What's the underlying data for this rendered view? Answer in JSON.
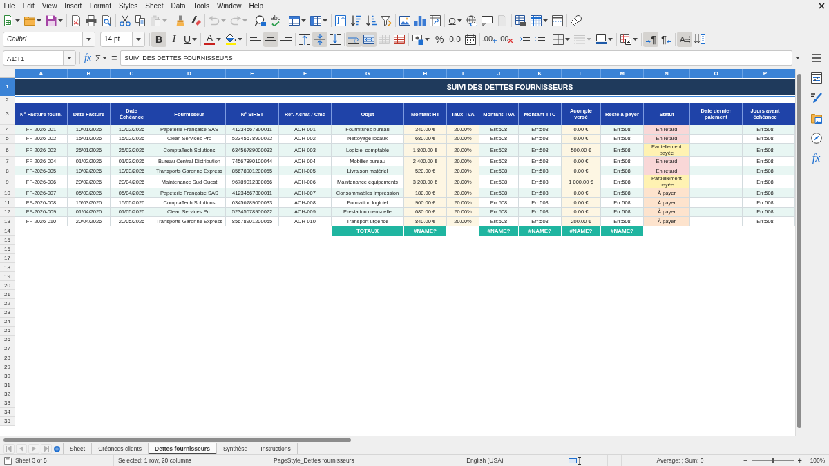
{
  "menu_bar": {
    "items": [
      "File",
      "Edit",
      "View",
      "Insert",
      "Format",
      "Styles",
      "Sheet",
      "Data",
      "Tools",
      "Window",
      "Help"
    ]
  },
  "standard_toolbar": {
    "groups": [
      [
        {
          "kind": "new",
          "dropdown": true,
          "disabled": false
        },
        {
          "kind": "open",
          "dropdown": true,
          "disabled": false
        },
        {
          "kind": "save",
          "dropdown": true,
          "disabled": false
        }
      ],
      [
        {
          "kind": "pdf",
          "dropdown": false,
          "disabled": false
        },
        {
          "kind": "print",
          "dropdown": false,
          "disabled": false
        },
        {
          "kind": "preview",
          "dropdown": false,
          "disabled": false
        }
      ],
      [
        {
          "kind": "cut",
          "dropdown": false,
          "disabled": false
        },
        {
          "kind": "copy",
          "dropdown": false,
          "disabled": false
        },
        {
          "kind": "paste",
          "dropdown": true,
          "disabled": true
        }
      ],
      [
        {
          "kind": "clone",
          "dropdown": false,
          "disabled": false
        },
        {
          "kind": "clear",
          "dropdown": false,
          "disabled": false
        }
      ],
      [
        {
          "kind": "undo",
          "dropdown": true,
          "disabled": true
        },
        {
          "kind": "redo",
          "dropdown": true,
          "disabled": true
        }
      ],
      [
        {
          "kind": "find",
          "dropdown": false,
          "disabled": false
        },
        {
          "kind": "spelling",
          "label": "abc",
          "dropdown": false,
          "disabled": false
        }
      ],
      [
        {
          "kind": "rows",
          "dropdown": true,
          "disabled": false
        },
        {
          "kind": "columns",
          "dropdown": true,
          "disabled": false
        }
      ],
      [
        {
          "kind": "sort",
          "dropdown": false,
          "disabled": false
        },
        {
          "kind": "ascending",
          "dropdown": false,
          "disabled": false
        },
        {
          "kind": "descending",
          "dropdown": false,
          "disabled": false
        },
        {
          "kind": "filter",
          "dropdown": false,
          "disabled": false
        }
      ],
      [
        {
          "kind": "image",
          "dropdown": false,
          "disabled": false
        },
        {
          "kind": "chart",
          "dropdown": false,
          "disabled": false
        },
        {
          "kind": "pivot",
          "dropdown": false,
          "disabled": false
        }
      ],
      [
        {
          "kind": "special",
          "label": "Ω",
          "dropdown": true,
          "disabled": false
        },
        {
          "kind": "hyperlink",
          "dropdown": false,
          "disabled": false
        },
        {
          "kind": "comment",
          "dropdown": false,
          "disabled": false
        },
        {
          "kind": "headers",
          "dropdown": false,
          "disabled": true
        }
      ],
      [
        {
          "kind": "printarea",
          "dropdown": false,
          "disabled": false
        },
        {
          "kind": "freeze",
          "dropdown": true,
          "disabled": false
        },
        {
          "kind": "split",
          "dropdown": false,
          "disabled": false
        }
      ],
      [
        {
          "kind": "shapes",
          "dropdown": false,
          "disabled": false
        }
      ]
    ]
  },
  "formatting_toolbar": {
    "font_name": "Calibri",
    "font_size": "14 pt",
    "groups": [
      [
        {
          "kind": "bold",
          "label": "B",
          "on": true,
          "disabled": false,
          "dropdown": false
        },
        {
          "kind": "italic",
          "label": "I",
          "on": false,
          "disabled": false,
          "dropdown": false
        },
        {
          "kind": "underline",
          "label": "U",
          "on": false,
          "disabled": false,
          "dropdown": true
        }
      ],
      [
        {
          "kind": "fontcolor",
          "label": "A",
          "color": "#c9211e",
          "on": false,
          "disabled": false,
          "dropdown": true
        },
        {
          "kind": "highlight",
          "color": "#ffee00",
          "on": false,
          "disabled": false,
          "dropdown": true
        }
      ],
      [
        {
          "kind": "left",
          "on": false,
          "disabled": false,
          "dropdown": false
        },
        {
          "kind": "center",
          "on": true,
          "disabled": false,
          "dropdown": false
        },
        {
          "kind": "right",
          "on": false,
          "disabled": false,
          "dropdown": false
        }
      ],
      [
        {
          "kind": "top",
          "on": false,
          "disabled": false,
          "dropdown": false
        },
        {
          "kind": "middle",
          "on": true,
          "disabled": false,
          "dropdown": false
        },
        {
          "kind": "bottom",
          "on": false,
          "disabled": false,
          "dropdown": false
        }
      ],
      [
        {
          "kind": "wrap",
          "on": true,
          "disabled": false,
          "dropdown": false
        },
        {
          "kind": "mergecenter",
          "on": true,
          "disabled": false,
          "dropdown": false
        },
        {
          "kind": "merge",
          "on": false,
          "disabled": true,
          "dropdown": false
        },
        {
          "kind": "unmerge",
          "on": false,
          "disabled": false,
          "dropdown": false
        }
      ],
      [
        {
          "kind": "currency",
          "on": false,
          "disabled": false,
          "dropdown": true
        },
        {
          "kind": "percent",
          "label": "%",
          "on": false,
          "disabled": false,
          "dropdown": false
        },
        {
          "kind": "number",
          "label": "0.0",
          "on": false,
          "disabled": false,
          "dropdown": false
        },
        {
          "kind": "date",
          "on": false,
          "disabled": false,
          "dropdown": false
        }
      ],
      [
        {
          "kind": "adddecimal",
          "label": ".00",
          "on": false,
          "disabled": false,
          "dropdown": false
        },
        {
          "kind": "deldecimal",
          "label": ".00",
          "on": false,
          "disabled": false,
          "dropdown": false
        }
      ],
      [
        {
          "kind": "indent",
          "on": false,
          "disabled": false,
          "dropdown": false
        },
        {
          "kind": "outdent",
          "on": false,
          "disabled": false,
          "dropdown": false
        }
      ],
      [
        {
          "kind": "borders",
          "on": false,
          "disabled": false,
          "dropdown": true
        },
        {
          "kind": "borderstyle",
          "on": false,
          "disabled": true,
          "dropdown": true
        },
        {
          "kind": "bordercolor",
          "color": "#1e5aa8",
          "on": false,
          "disabled": false,
          "dropdown": true
        }
      ],
      [
        {
          "kind": "conditional",
          "on": false,
          "disabled": false,
          "dropdown": true
        }
      ],
      [
        {
          "kind": "ltr",
          "label": "¶",
          "on": true,
          "disabled": false,
          "dropdown": false
        },
        {
          "kind": "rtl",
          "label": "¶",
          "on": false,
          "disabled": false,
          "dropdown": false
        }
      ],
      [
        {
          "kind": "horizontal",
          "label": "A",
          "on": true,
          "disabled": false,
          "dropdown": false
        },
        {
          "kind": "vertical",
          "on": false,
          "disabled": false,
          "dropdown": false
        }
      ]
    ]
  },
  "formula_bar": {
    "name_box": "A1:T1",
    "function_wizard": "fx",
    "sum": "Σ",
    "formula": "=",
    "content": "SUIVI DES DETTES FOURNISSEURS"
  },
  "sheet": {
    "column_headers": [
      {
        "label": "A",
        "selected": true
      },
      {
        "label": "B",
        "selected": true
      },
      {
        "label": "C",
        "selected": true
      },
      {
        "label": "D",
        "selected": true
      },
      {
        "label": "E",
        "selected": true
      },
      {
        "label": "F",
        "selected": true
      },
      {
        "label": "G",
        "selected": true
      },
      {
        "label": "H",
        "selected": true
      },
      {
        "label": "I",
        "selected": true
      },
      {
        "label": "J",
        "selected": true
      },
      {
        "label": "K",
        "selected": true
      },
      {
        "label": "L",
        "selected": true
      },
      {
        "label": "M",
        "selected": true
      },
      {
        "label": "N",
        "selected": true
      },
      {
        "label": "O",
        "selected": true
      },
      {
        "label": "P",
        "selected": true
      }
    ],
    "row_numbers": [
      {
        "label": "1",
        "selected": true
      },
      {
        "label": "2",
        "selected": false
      },
      {
        "label": "3",
        "selected": false
      },
      {
        "label": "4",
        "selected": false
      },
      {
        "label": "5",
        "selected": false
      },
      {
        "label": "6",
        "selected": false
      },
      {
        "label": "7",
        "selected": false
      },
      {
        "label": "8",
        "selected": false
      },
      {
        "label": "9",
        "selected": false
      },
      {
        "label": "10",
        "selected": false
      },
      {
        "label": "11",
        "selected": false
      },
      {
        "label": "12",
        "selected": false
      },
      {
        "label": "13",
        "selected": false
      },
      {
        "label": "14",
        "selected": false
      },
      {
        "label": "15",
        "selected": false
      },
      {
        "label": "16",
        "selected": false
      },
      {
        "label": "17",
        "selected": false
      },
      {
        "label": "18",
        "selected": false
      },
      {
        "label": "19",
        "selected": false
      },
      {
        "label": "20",
        "selected": false
      },
      {
        "label": "21",
        "selected": false
      },
      {
        "label": "22",
        "selected": false
      },
      {
        "label": "23",
        "selected": false
      },
      {
        "label": "24",
        "selected": false
      },
      {
        "label": "25",
        "selected": false
      },
      {
        "label": "26",
        "selected": false
      },
      {
        "label": "27",
        "selected": false
      },
      {
        "label": "28",
        "selected": false
      },
      {
        "label": "29",
        "selected": false
      },
      {
        "label": "30",
        "selected": false
      },
      {
        "label": "31",
        "selected": false
      },
      {
        "label": "32",
        "selected": false
      },
      {
        "label": "33",
        "selected": false
      },
      {
        "label": "34",
        "selected": false
      },
      {
        "label": "35",
        "selected": false
      }
    ],
    "title": "SUIVI DES DETTES FOURNISSEURS",
    "table": {
      "columns": [
        "N° Facture fourn.",
        "Date Facture",
        "Date Échéance",
        "Fournisseur",
        "N° SIRET",
        "Réf. Achat / Cmd",
        "Objet",
        "Montant HT",
        "Taux TVA",
        "Montant TVA",
        "Montant TTC",
        "Acompte versé",
        "Reste à payer",
        "Statut",
        "Date dernier paiement",
        "Jours avant échéance"
      ],
      "rows": [
        {
          "invoice": "FF-2026-001",
          "invoice_date": "10/01/2026",
          "due_date": "10/02/2026",
          "supplier": "Papeterie Française SAS",
          "siret": "41234567800011",
          "order_ref": "ACH-001",
          "object": "Fournitures bureau",
          "amount_ht": "340.00 €",
          "vat_rate": "20.00%",
          "vat_amount": "Err:508",
          "amount_ttc": "Err:508",
          "deposit": "0.00 €",
          "remaining": "Err:508",
          "status": "En retard",
          "color": "#f9d7d7",
          "days_to_due": "Err:508"
        },
        {
          "invoice": "FF-2026-002",
          "invoice_date": "15/01/2026",
          "due_date": "15/02/2026",
          "supplier": "Clean Services Pro",
          "siret": "52345678900022",
          "order_ref": "ACH-002",
          "object": "Nettoyage locaux",
          "amount_ht": "680.00 €",
          "vat_rate": "20.00%",
          "vat_amount": "Err:508",
          "amount_ttc": "Err:508",
          "deposit": "0.00 €",
          "remaining": "Err:508",
          "status": "En retard",
          "color": "#f9d7d7",
          "days_to_due": "Err:508"
        },
        {
          "invoice": "FF-2026-003",
          "invoice_date": "25/01/2026",
          "due_date": "25/03/2026",
          "supplier": "ComptaTech Solutions",
          "siret": "63456789000033",
          "order_ref": "ACH-003",
          "object": "Logiciel comptable",
          "amount_ht": "1 800.00 €",
          "vat_rate": "20.00%",
          "vat_amount": "Err:508",
          "amount_ttc": "Err:508",
          "deposit": "500.00 €",
          "remaining": "Err:508",
          "status": "Partiellement payée",
          "color": "#fff2b2",
          "days_to_due": "Err:508"
        },
        {
          "invoice": "FF-2026-004",
          "invoice_date": "01/02/2026",
          "due_date": "01/03/2026",
          "supplier": "Bureau Central Distribution",
          "siret": "74567890100044",
          "order_ref": "ACH-004",
          "object": "Mobilier bureau",
          "amount_ht": "2 400.00 €",
          "vat_rate": "20.00%",
          "vat_amount": "Err:508",
          "amount_ttc": "Err:508",
          "deposit": "0.00 €",
          "remaining": "Err:508",
          "status": "En retard",
          "color": "#f9d7d7",
          "days_to_due": "Err:508"
        },
        {
          "invoice": "FF-2026-005",
          "invoice_date": "10/02/2026",
          "due_date": "10/03/2026",
          "supplier": "Transports Garonne Express",
          "siret": "85678901200055",
          "order_ref": "ACH-005",
          "object": "Livraison matériel",
          "amount_ht": "520.00 €",
          "vat_rate": "20.00%",
          "vat_amount": "Err:508",
          "amount_ttc": "Err:508",
          "deposit": "0.00 €",
          "remaining": "Err:508",
          "status": "En retard",
          "color": "#f9d7d7",
          "days_to_due": "Err:508"
        },
        {
          "invoice": "FF-2026-006",
          "invoice_date": "20/02/2026",
          "due_date": "20/04/2026",
          "supplier": "Maintenance Sud Ouest",
          "siret": "96789012300066",
          "order_ref": "ACH-006",
          "object": "Maintenance équipements",
          "amount_ht": "3 200.00 €",
          "vat_rate": "20.00%",
          "vat_amount": "Err:508",
          "amount_ttc": "Err:508",
          "deposit": "1 000.00 €",
          "remaining": "Err:508",
          "status": "Partiellement payée",
          "color": "#fff2b2",
          "days_to_due": "Err:508"
        },
        {
          "invoice": "FF-2026-007",
          "invoice_date": "05/03/2026",
          "due_date": "05/04/2026",
          "supplier": "Papeterie Française SAS",
          "siret": "41234567800011",
          "order_ref": "ACH-007",
          "object": "Consommables impression",
          "amount_ht": "180.00 €",
          "vat_rate": "20.00%",
          "vat_amount": "Err:508",
          "amount_ttc": "Err:508",
          "deposit": "0.00 €",
          "remaining": "Err:508",
          "status": "À payer",
          "color": "#fde3cd",
          "days_to_due": "Err:508"
        },
        {
          "invoice": "FF-2026-008",
          "invoice_date": "15/03/2026",
          "due_date": "15/05/2026",
          "supplier": "ComptaTech Solutions",
          "siret": "63456789000033",
          "order_ref": "ACH-008",
          "object": "Formation logiciel",
          "amount_ht": "960.00 €",
          "vat_rate": "20.00%",
          "vat_amount": "Err:508",
          "amount_ttc": "Err:508",
          "deposit": "0.00 €",
          "remaining": "Err:508",
          "status": "À payer",
          "color": "#fde3cd",
          "days_to_due": "Err:508"
        },
        {
          "invoice": "FF-2026-009",
          "invoice_date": "01/04/2026",
          "due_date": "01/05/2026",
          "supplier": "Clean Services Pro",
          "siret": "52345678900022",
          "order_ref": "ACH-009",
          "object": "Prestation mensuelle",
          "amount_ht": "680.00 €",
          "vat_rate": "20.00%",
          "vat_amount": "Err:508",
          "amount_ttc": "Err:508",
          "deposit": "0.00 €",
          "remaining": "Err:508",
          "status": "À payer",
          "color": "#fde3cd",
          "days_to_due": "Err:508"
        },
        {
          "invoice": "FF-2026-010",
          "invoice_date": "20/04/2026",
          "due_date": "20/05/2026",
          "supplier": "Transports Garonne Express",
          "siret": "85678901200055",
          "order_ref": "ACH-010",
          "object": "Transport urgence",
          "amount_ht": "840.00 €",
          "vat_rate": "20.00%",
          "vat_amount": "Err:508",
          "amount_ttc": "Err:508",
          "deposit": "200.00 €",
          "remaining": "Err:508",
          "status": "À payer",
          "color": "#fde3cd",
          "days_to_due": "Err:508"
        }
      ],
      "totals": {
        "object": "TOTAUX",
        "amount_ht": "#NAME?",
        "vat_amount": "#NAME?",
        "amount_ttc": "#NAME?",
        "deposit": "#NAME?",
        "remaining": "#NAME?"
      }
    }
  },
  "sidebar": {
    "buttons": [
      {
        "kind": "menu"
      },
      {
        "kind": "properties"
      },
      {
        "kind": "styles"
      },
      {
        "kind": "gallery"
      },
      {
        "kind": "navigator"
      },
      {
        "kind": "functions",
        "label": "fx"
      }
    ]
  },
  "sheet_tabs": {
    "navigation": [
      {
        "kind": "first",
        "disabled": true
      },
      {
        "kind": "previous",
        "disabled": true
      },
      {
        "kind": "next",
        "disabled": true
      },
      {
        "kind": "last",
        "disabled": true
      }
    ],
    "tabs": [
      {
        "label": "Sheet",
        "selected": false
      },
      {
        "label": "Créances clients",
        "selected": false
      },
      {
        "label": "Dettes fournisseurs",
        "selected": true
      },
      {
        "label": "Synthèse",
        "selected": false
      },
      {
        "label": "Instructions",
        "selected": false
      }
    ]
  },
  "status_bar": {
    "sheet_position": "Sheet 3 of 5",
    "selection": "Selected: 1 row, 20 columns",
    "page_style": "PageStyle_Dettes fournisseurs",
    "language": "English (USA)",
    "summary": "Average: ; Sum: 0",
    "zoom": {
      "out": "−",
      "level": 0.5,
      "in": "+",
      "percent": "100%"
    }
  }
}
